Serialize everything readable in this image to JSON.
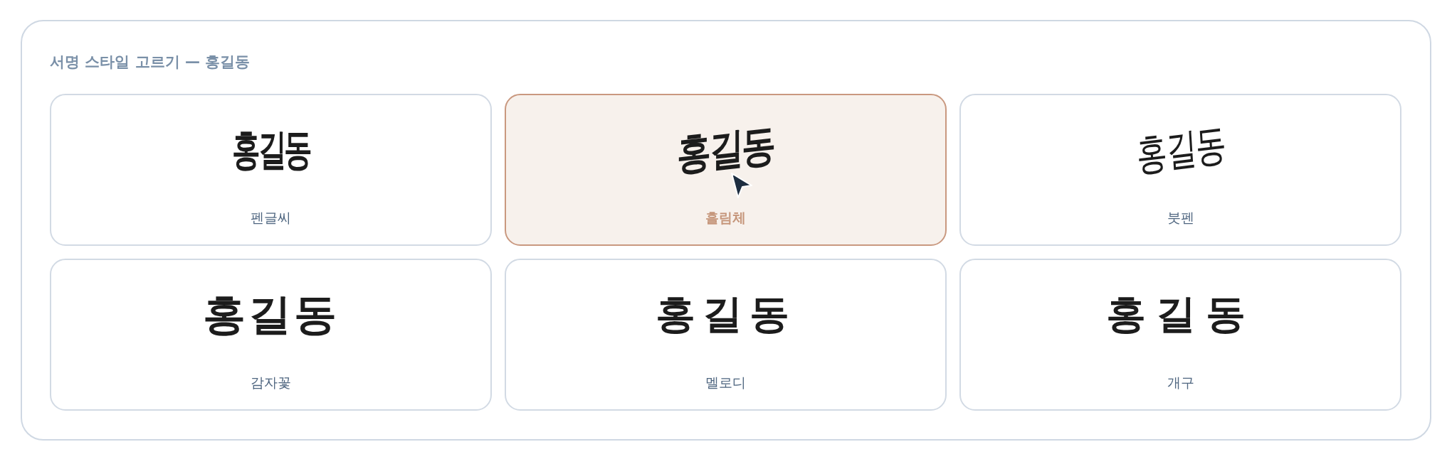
{
  "panel": {
    "title": "서명 스타일 고르기 — 홍길동"
  },
  "cards": [
    {
      "kind": "pen",
      "signature": "홍길동",
      "label": "펜글씨",
      "selected": false,
      "cursor_over": false
    },
    {
      "kind": "brush",
      "signature": "홍길동",
      "label": "흘림체",
      "selected": true,
      "cursor_over": true
    },
    {
      "kind": "marker",
      "signature": "홍길동",
      "label": "붓펜",
      "selected": false,
      "cursor_over": false
    },
    {
      "kind": "round",
      "signature": "홍길동",
      "label": "감자꽃",
      "selected": false,
      "cursor_over": false
    },
    {
      "kind": "thin",
      "signature": "홍길동",
      "label": "멜로디",
      "selected": false,
      "cursor_over": false
    },
    {
      "kind": "wide",
      "signature": "홍길동",
      "label": "개구",
      "selected": false,
      "cursor_over": false
    }
  ]
}
